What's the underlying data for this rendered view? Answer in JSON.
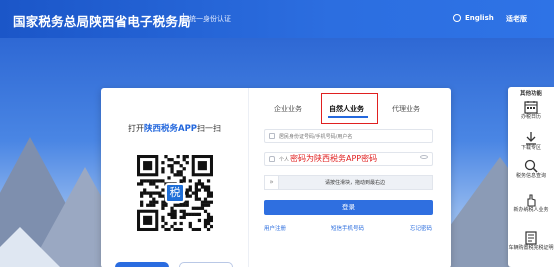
{
  "header": {
    "brand": "国家税务总局陕西省电子税务局",
    "subtitle": "统一身份认证",
    "lang_label": "English",
    "access_label": "适老版"
  },
  "login": {
    "scan_prefix": "打开",
    "scan_app": "陕西税务APP",
    "scan_suffix": "扫一扫",
    "qr_logo": "税",
    "tabs": [
      "企业业务",
      "自然人业务",
      "代理业务"
    ],
    "active_tab": "自然人业务",
    "account_placeholder": "居民身份证号码/手机号码/用户名",
    "password_placeholder": "个人",
    "password_annotation": "密码为陕西税务APP密码",
    "slider_arrow": "»",
    "slider_text": "请按住滑块，拖动到最右边",
    "login_button": "登录",
    "links": {
      "register": "用户注册",
      "phone_login": "短信手机号码",
      "forgot": "忘记密码"
    }
  },
  "sidebar": {
    "title": "其他功能",
    "items": [
      {
        "icon": "calendar-icon",
        "label": "办税日历"
      },
      {
        "icon": "download-icon",
        "label": "下载专区"
      },
      {
        "icon": "search-icon",
        "label": "税务信息查询"
      },
      {
        "icon": "hand-icon",
        "label": "新办纳税人业务"
      },
      {
        "icon": "document-icon",
        "label": "车辆购置税完税证明"
      }
    ]
  },
  "colors": {
    "accent": "#2468dd",
    "header": "#2c6ee0",
    "highlight_red": "#e02020"
  }
}
